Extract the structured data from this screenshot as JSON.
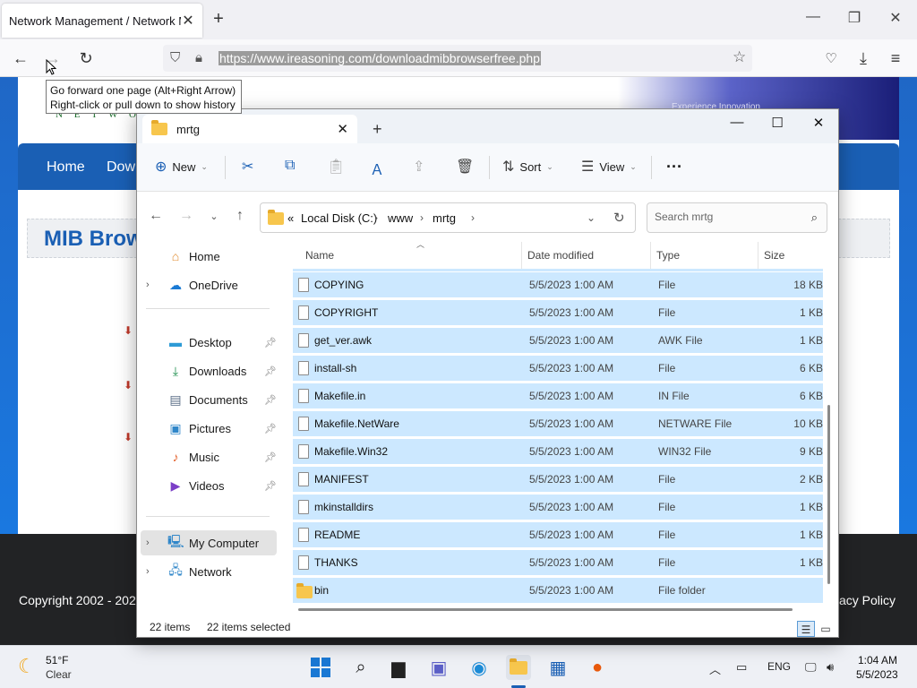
{
  "browser": {
    "tab_title": "Network Management / Network M",
    "url": "https://www.ireasoning.com/downloadmibbrowserfree.php",
    "tooltip_line1": "Go forward one page (Alt+Right Arrow)",
    "tooltip_line2": "Right-click or pull down to show history"
  },
  "webpage": {
    "logo_fragment": "N E T W O R",
    "banner_text": "Experience Innovation",
    "nav_home": "Home",
    "nav_download": "Dow",
    "title": "MIB Brow",
    "footer_copyright": "Copyright 2002 - 202",
    "footer_privacy": "vacy Policy"
  },
  "explorer": {
    "tab_title": "mrtg",
    "commands": {
      "new": "New",
      "sort": "Sort",
      "view": "View"
    },
    "address": {
      "prefix": "«",
      "segments": [
        "Local Disk (C:)",
        "www",
        "mrtg"
      ]
    },
    "search_placeholder": "Search mrtg",
    "nav": {
      "home": "Home",
      "onedrive": "OneDrive",
      "desktop": "Desktop",
      "downloads": "Downloads",
      "documents": "Documents",
      "pictures": "Pictures",
      "music": "Music",
      "videos": "Videos",
      "my_computer": "My Computer",
      "network": "Network"
    },
    "columns": {
      "name": "Name",
      "date": "Date modified",
      "type": "Type",
      "size": "Size"
    },
    "rows": [
      {
        "name": "COPYING",
        "date": "5/5/2023 1:00 AM",
        "type": "File",
        "size": "18 KB"
      },
      {
        "name": "COPYRIGHT",
        "date": "5/5/2023 1:00 AM",
        "type": "File",
        "size": "1 KB"
      },
      {
        "name": "get_ver.awk",
        "date": "5/5/2023 1:00 AM",
        "type": "AWK File",
        "size": "1 KB"
      },
      {
        "name": "install-sh",
        "date": "5/5/2023 1:00 AM",
        "type": "File",
        "size": "6 KB"
      },
      {
        "name": "Makefile.in",
        "date": "5/5/2023 1:00 AM",
        "type": "IN File",
        "size": "6 KB"
      },
      {
        "name": "Makefile.NetWare",
        "date": "5/5/2023 1:00 AM",
        "type": "NETWARE File",
        "size": "10 KB"
      },
      {
        "name": "Makefile.Win32",
        "date": "5/5/2023 1:00 AM",
        "type": "WIN32 File",
        "size": "9 KB"
      },
      {
        "name": "MANIFEST",
        "date": "5/5/2023 1:00 AM",
        "type": "File",
        "size": "2 KB"
      },
      {
        "name": "mkinstalldirs",
        "date": "5/5/2023 1:00 AM",
        "type": "File",
        "size": "1 KB"
      },
      {
        "name": "README",
        "date": "5/5/2023 1:00 AM",
        "type": "File",
        "size": "1 KB"
      },
      {
        "name": "THANKS",
        "date": "5/5/2023 1:00 AM",
        "type": "File",
        "size": "1 KB"
      },
      {
        "name": "bin",
        "date": "5/5/2023 1:00 AM",
        "type": "File folder",
        "size": ""
      }
    ],
    "status_count": "22 items",
    "status_selected": "22 items selected"
  },
  "taskbar": {
    "temperature": "51°F",
    "condition": "Clear",
    "language": "ENG",
    "time": "1:04 AM",
    "date": "5/5/2023"
  },
  "colors": {
    "selection": "#cce8ff",
    "accent": "#1a5fb4",
    "page_blue": "#1d6fd1"
  }
}
